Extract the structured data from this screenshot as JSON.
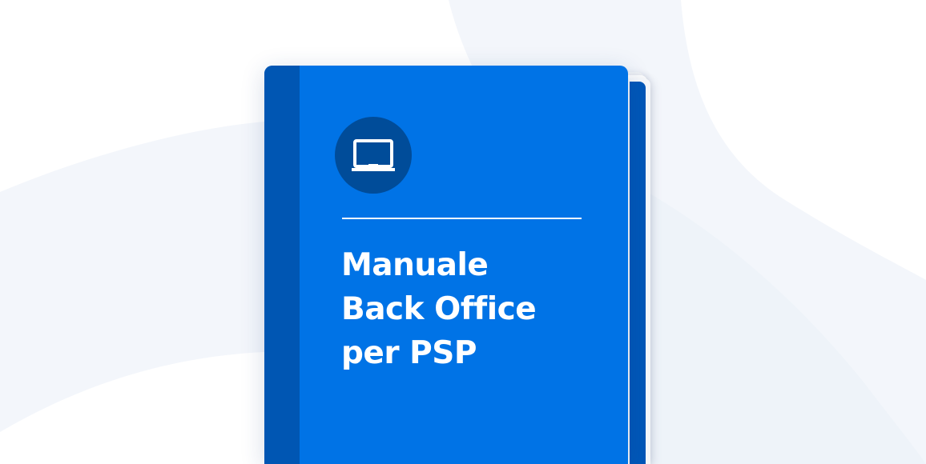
{
  "book": {
    "title_lines": [
      "Manuale",
      "Back Office",
      "per PSP"
    ],
    "icon": "laptop-icon"
  },
  "colors": {
    "cover": "#0073e6",
    "spine": "#0056b3",
    "icon_circle": "#004c99",
    "background_shape": "#eef3f9"
  }
}
